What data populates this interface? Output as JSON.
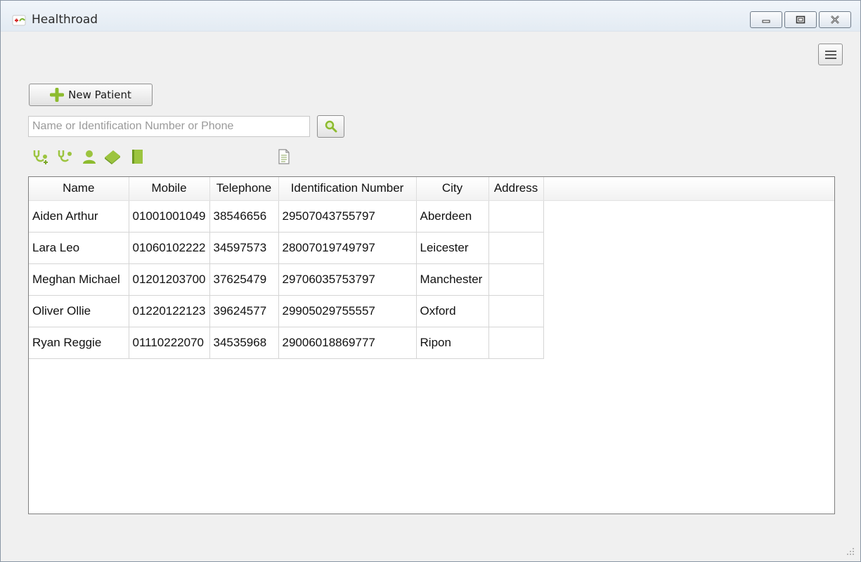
{
  "window": {
    "title": "Healthroad"
  },
  "toolbar": {
    "new_patient_label": "New Patient",
    "search_placeholder": "Name or Identification Number or Phone",
    "search_value": "",
    "icons": [
      "stethoscope-add-icon",
      "stethoscope-icon",
      "user-icon",
      "book-icon",
      "notebook-icon",
      "document-icon"
    ]
  },
  "table": {
    "columns": [
      "Name",
      "Mobile",
      "Telephone",
      "Identification Number",
      "City",
      "Address"
    ],
    "rows": [
      [
        "Aiden Arthur",
        "01001001049",
        "38546656",
        "29507043755797",
        "Aberdeen",
        ""
      ],
      [
        "Lara Leo",
        "01060102222",
        "34597573",
        "28007019749797",
        "Leicester",
        ""
      ],
      [
        "Meghan Michael",
        "01201203700",
        "37625479",
        "29706035753797",
        "Manchester",
        ""
      ],
      [
        "Oliver Ollie",
        "01220122123",
        "39624577",
        "29905029755557",
        "Oxford",
        ""
      ],
      [
        "Ryan Reggie",
        "01110222070",
        "34535968",
        "29006018869777",
        "Ripon",
        ""
      ]
    ]
  },
  "colors": {
    "accent_green": "#8dbb2f",
    "window_bg": "#f0f0f0"
  }
}
